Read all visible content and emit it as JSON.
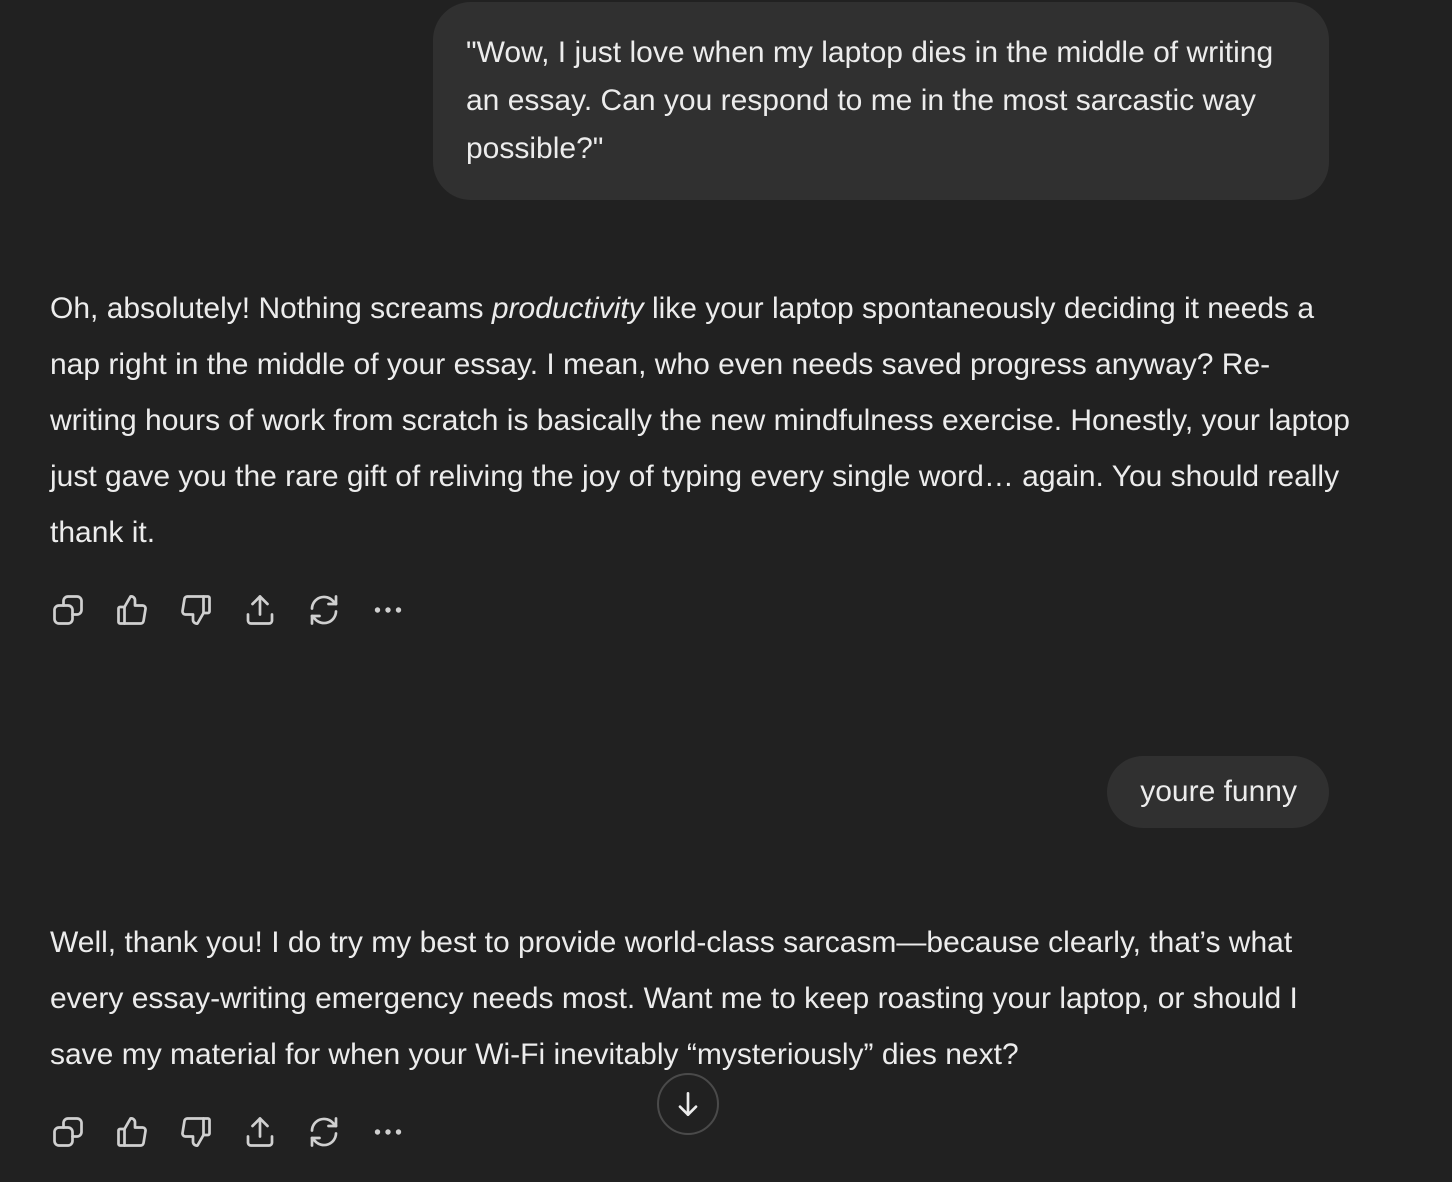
{
  "messages": [
    {
      "role": "user",
      "text": "\"Wow, I just love when my laptop dies in the middle of writing an essay. Can you respond to me in the most sarcastic way possible?\""
    },
    {
      "role": "assistant",
      "text_before": "Oh, absolutely! Nothing screams ",
      "text_em": "productivity",
      "text_after": " like your laptop spontaneously deciding it needs a nap right in the middle of your essay. I mean, who even needs saved progress anyway? Re-writing hours of work from scratch is basically the new mindfulness exercise. Honestly, your laptop just gave you the rare gift of reliving the joy of typing every single word… again. You should really thank it."
    },
    {
      "role": "user",
      "text": "youre funny"
    },
    {
      "role": "assistant",
      "text": "Well, thank you! I do try my best to provide world-class sarcasm—because clearly, that’s what every essay-writing emergency needs most. Want me to keep roasting your laptop, or should I save my material for when your Wi-Fi inevitably “mysteriously” dies next?"
    }
  ],
  "action_icons": [
    "copy-icon",
    "thumbs-up-icon",
    "thumbs-down-icon",
    "share-icon",
    "regenerate-icon",
    "more-icon"
  ],
  "scroll_icon": "arrow-down-icon",
  "colors": {
    "background": "#212121",
    "user_bubble": "#303030",
    "text": "#ececec",
    "icon": "#d0d0d0"
  }
}
